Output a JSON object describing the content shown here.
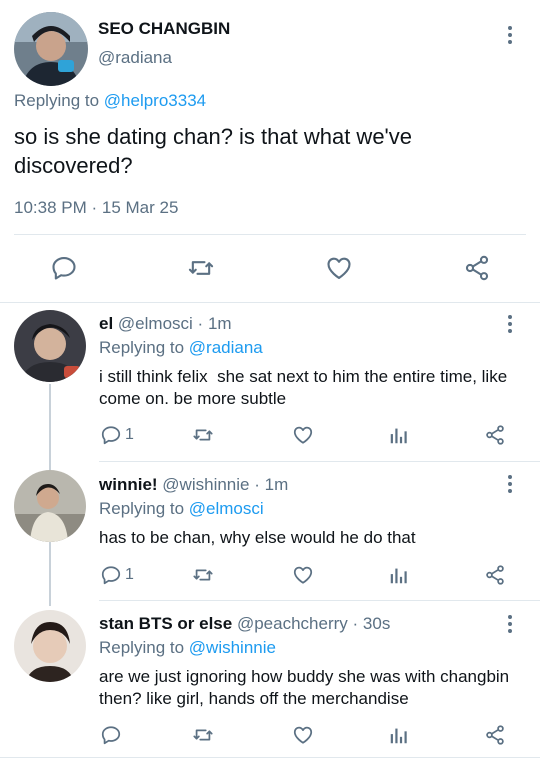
{
  "main_tweet": {
    "display_name": "SEO CHANGBIN",
    "handle": "@radiana",
    "replying_prefix": "Replying to ",
    "replying_handle": "@helpro3334",
    "body": "so is she dating chan? is that what we've discovered?",
    "timestamp": "10:38 PM · 15 Mar 25"
  },
  "replies": [
    {
      "display_name": "el",
      "handle": "@elmosci",
      "sep": "·",
      "time": "1m",
      "replying_prefix": "Replying to ",
      "replying_handle": "@radiana",
      "body": "i still think felix  she sat next to him the entire time, like come on. be more subtle",
      "reply_count": "1"
    },
    {
      "display_name": "winnie!",
      "handle": "@wishinnie",
      "sep": "·",
      "time": "1m",
      "replying_prefix": "Replying to ",
      "replying_handle": "@elmosci",
      "body": "has to be chan, why else would he do that",
      "reply_count": "1"
    },
    {
      "display_name": "stan BTS or else",
      "handle": "@peachcherry",
      "sep": "·",
      "time": "30s",
      "replying_prefix": "Replying to ",
      "replying_handle": "@wishinnie",
      "body": "are we just ignoring how buddy she was with changbin then? like girl, hands off the merchandise",
      "reply_count": ""
    }
  ],
  "icons": {
    "reply": "reply-icon",
    "retweet": "retweet-icon",
    "like": "like-icon",
    "analytics": "analytics-icon",
    "share": "share-icon",
    "more": "more-options-icon"
  },
  "colors": {
    "link": "#1d9bf0",
    "muted": "#5b7083",
    "text": "#0f1419",
    "divider": "#e1e8ed"
  }
}
